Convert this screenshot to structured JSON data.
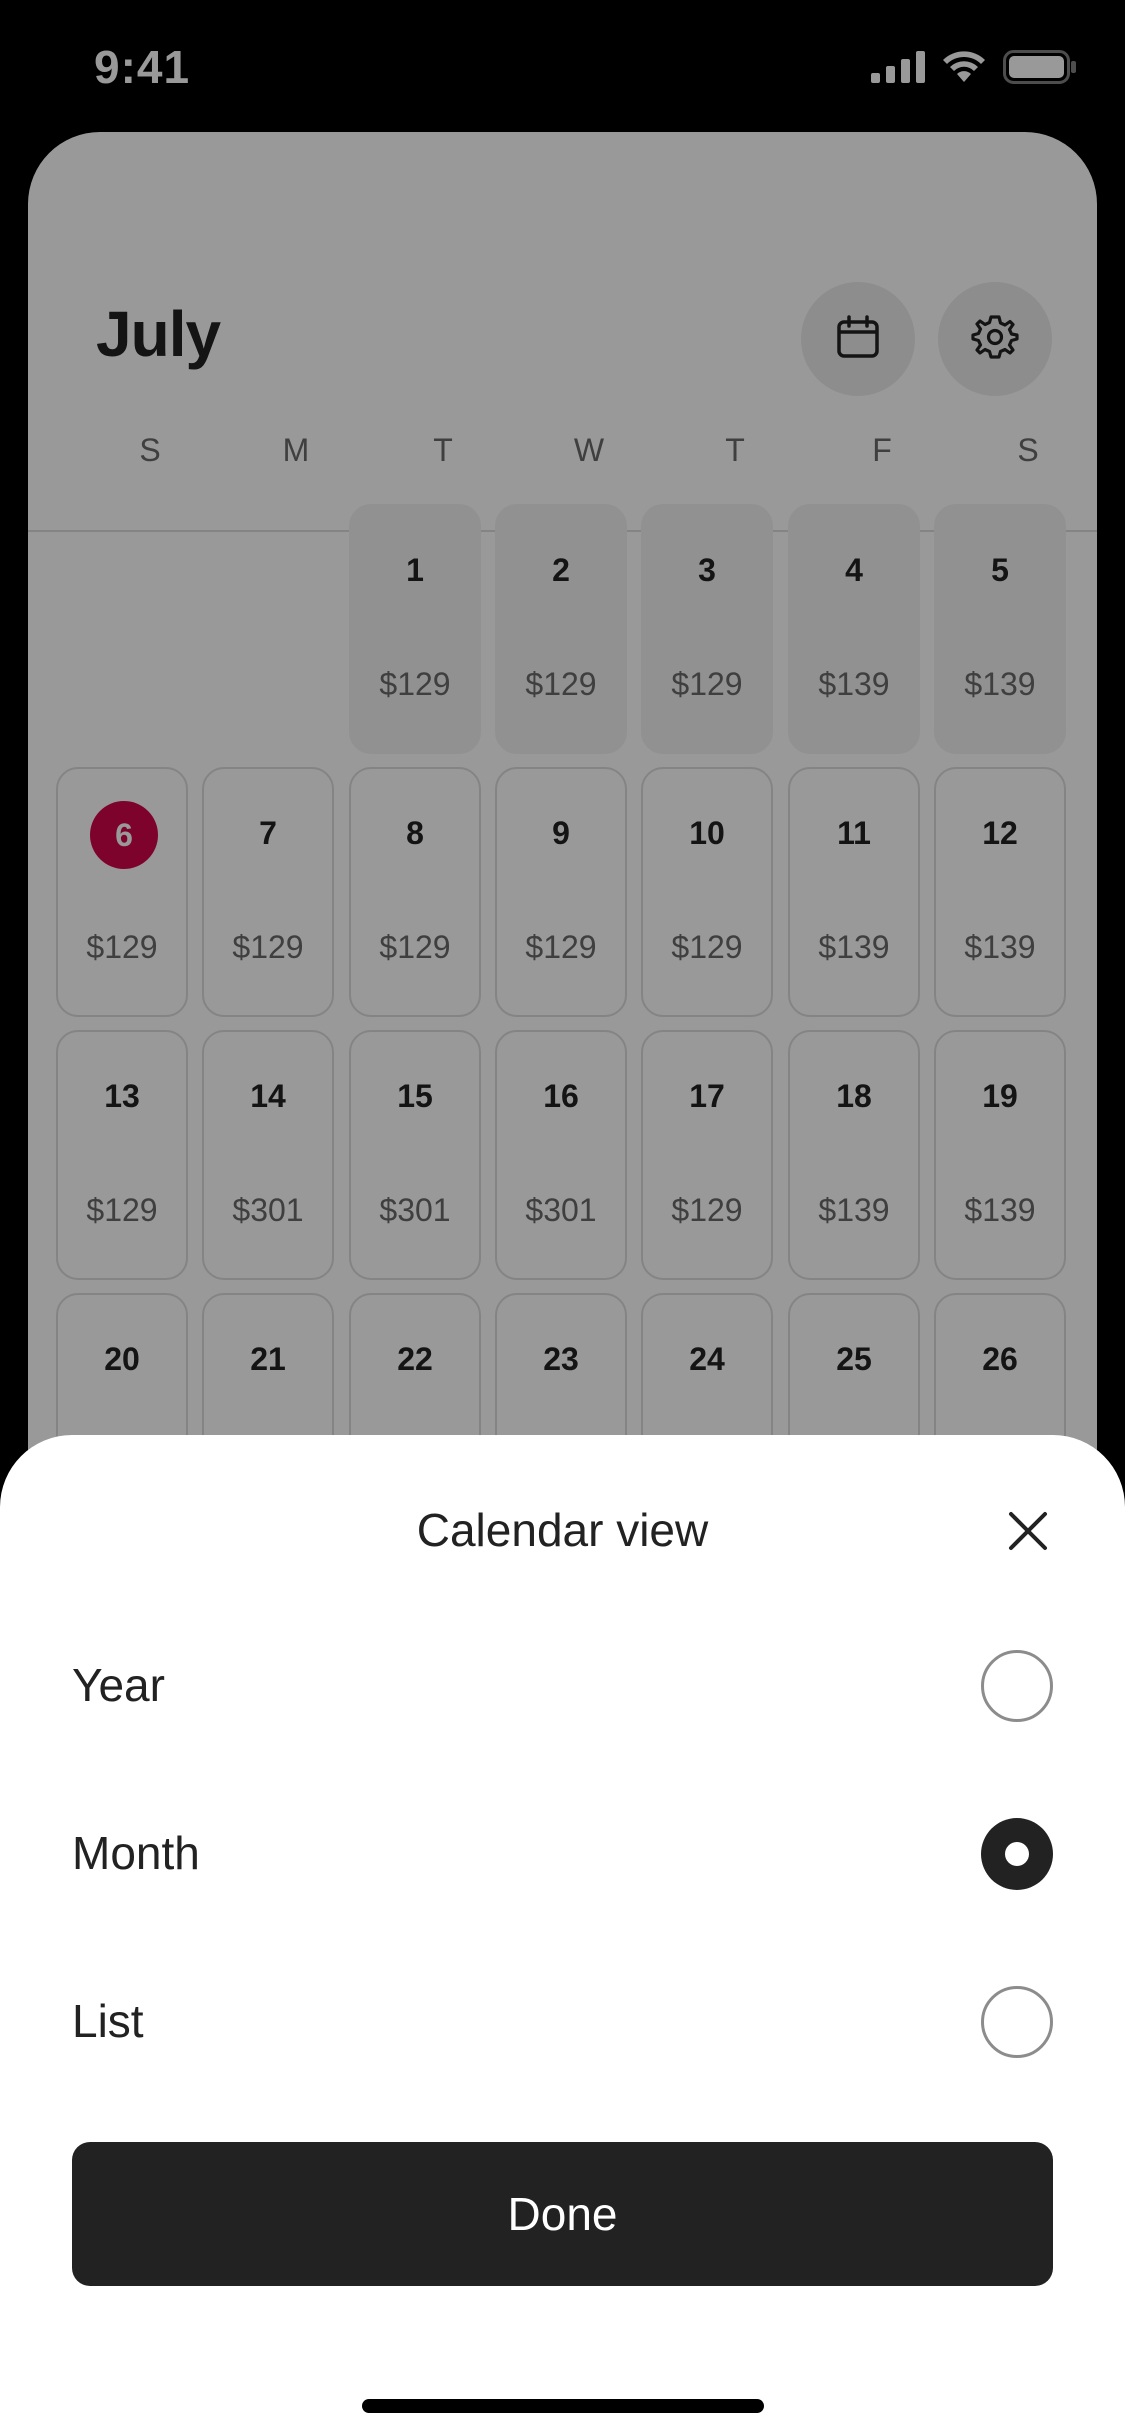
{
  "status_bar": {
    "time": "9:41",
    "icons": [
      "cellular-signal-icon",
      "wifi-icon",
      "battery-icon"
    ]
  },
  "header": {
    "month": "July",
    "calendar_button_icon": "calendar-icon",
    "settings_button_icon": "gear-icon"
  },
  "weekdays": [
    "S",
    "M",
    "T",
    "W",
    "T",
    "F",
    "S"
  ],
  "days": [
    {
      "day": "1",
      "price": "$129",
      "col": 2,
      "row": 0,
      "past": true
    },
    {
      "day": "2",
      "price": "$129",
      "col": 3,
      "row": 0,
      "past": true
    },
    {
      "day": "3",
      "price": "$129",
      "col": 4,
      "row": 0,
      "past": true
    },
    {
      "day": "4",
      "price": "$139",
      "col": 5,
      "row": 0,
      "past": true
    },
    {
      "day": "5",
      "price": "$139",
      "col": 6,
      "row": 0,
      "past": true
    },
    {
      "day": "6",
      "price": "$129",
      "col": 0,
      "row": 1,
      "today": true
    },
    {
      "day": "7",
      "price": "$129",
      "col": 1,
      "row": 1
    },
    {
      "day": "8",
      "price": "$129",
      "col": 2,
      "row": 1
    },
    {
      "day": "9",
      "price": "$129",
      "col": 3,
      "row": 1
    },
    {
      "day": "10",
      "price": "$129",
      "col": 4,
      "row": 1
    },
    {
      "day": "11",
      "price": "$139",
      "col": 5,
      "row": 1
    },
    {
      "day": "12",
      "price": "$139",
      "col": 6,
      "row": 1
    },
    {
      "day": "13",
      "price": "$129",
      "col": 0,
      "row": 2
    },
    {
      "day": "14",
      "price": "$301",
      "col": 1,
      "row": 2
    },
    {
      "day": "15",
      "price": "$301",
      "col": 2,
      "row": 2
    },
    {
      "day": "16",
      "price": "$301",
      "col": 3,
      "row": 2
    },
    {
      "day": "17",
      "price": "$129",
      "col": 4,
      "row": 2
    },
    {
      "day": "18",
      "price": "$139",
      "col": 5,
      "row": 2
    },
    {
      "day": "19",
      "price": "$139",
      "col": 6,
      "row": 2
    },
    {
      "day": "20",
      "price": "",
      "col": 0,
      "row": 3
    },
    {
      "day": "21",
      "price": "",
      "col": 1,
      "row": 3
    },
    {
      "day": "22",
      "price": "",
      "col": 2,
      "row": 3
    },
    {
      "day": "23",
      "price": "",
      "col": 3,
      "row": 3
    },
    {
      "day": "24",
      "price": "",
      "col": 4,
      "row": 3
    },
    {
      "day": "25",
      "price": "",
      "col": 5,
      "row": 3
    },
    {
      "day": "26",
      "price": "",
      "col": 6,
      "row": 3
    }
  ],
  "sheet": {
    "title": "Calendar view",
    "close_icon": "close-icon",
    "options": [
      {
        "label": "Year",
        "selected": false
      },
      {
        "label": "Month",
        "selected": true
      },
      {
        "label": "List",
        "selected": false
      }
    ],
    "done_label": "Done"
  },
  "colors": {
    "today_highlight": "#d1044a",
    "primary_dark": "#222222",
    "overlay": "rgba(0,0,0,0.4)"
  }
}
